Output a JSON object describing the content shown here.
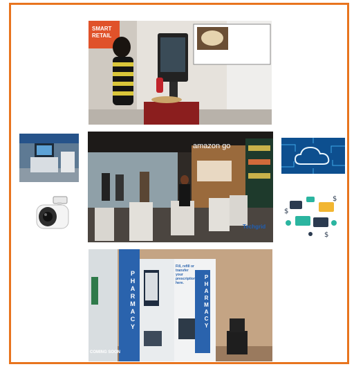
{
  "colors": {
    "frame_border": "#e8741e",
    "background": "#ffffff"
  },
  "photos": {
    "smart_retail": {
      "sign_line1": "SMART",
      "sign_line2": "RETAIL"
    },
    "amazon_go": {
      "store_sign": "amazon go",
      "watermark": "Techgrid"
    },
    "pharmacy_kiosk": {
      "banner": "PHARMACY",
      "screen_text": "Fill, refill or transfer your prescription here.",
      "coming_soon": "COMING SOON"
    }
  },
  "icons": [
    "self-checkout-photo",
    "security-camera-icon",
    "cloud-icon",
    "payment-cards-icon"
  ]
}
